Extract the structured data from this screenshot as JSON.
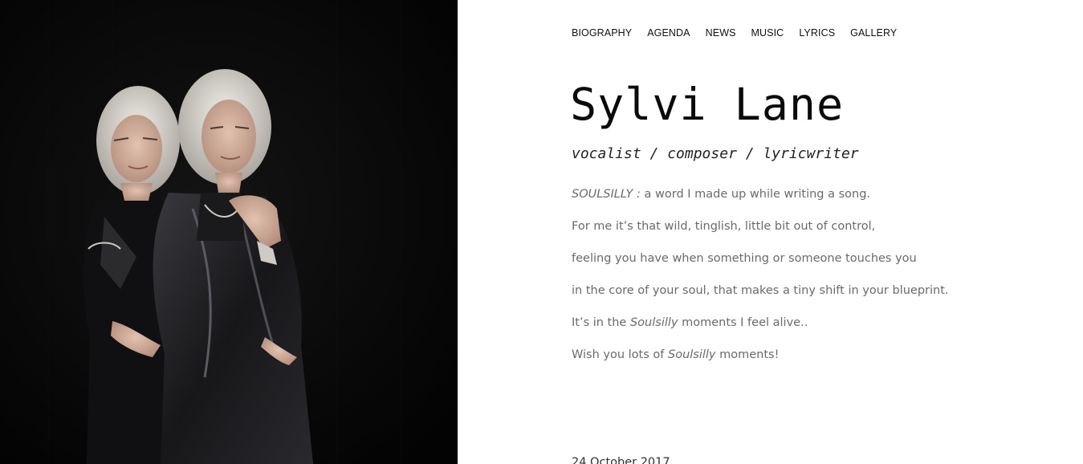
{
  "nav": {
    "items": [
      {
        "label": "BIOGRAPHY"
      },
      {
        "label": "AGENDA"
      },
      {
        "label": "NEWS"
      },
      {
        "label": "MUSIC"
      },
      {
        "label": "LYRICS"
      },
      {
        "label": "GALLERY"
      }
    ]
  },
  "header": {
    "title": "Sylvi Lane",
    "tagline": "vocalist / composer / lyricwriter"
  },
  "intro": {
    "line1_emphasis": "SOULSILLY :",
    "line1_rest": " a word I made up while writing a song.",
    "line2": "For me it’s that wild, tinglish, little bit out of control,",
    "line3": "feeling you have when something or someone touches you",
    "line4": "in the core of your soul, that makes a tiny shift in your blueprint.",
    "line5_pre": "It’s in the ",
    "line5_emphasis": "Soulsilly",
    "line5_post": " moments I feel alive..",
    "line6_pre": "Wish you lots of ",
    "line6_emphasis": "Soulsilly",
    "line6_post": " moments!"
  },
  "post": {
    "date": "24 October 2017"
  },
  "colors": {
    "photo_background": "#060606",
    "hair": "#d9d6d1",
    "skin": "#d8b3a0",
    "jacket": "#1c1c1e"
  },
  "photo": {
    "subject": "portrait-photo-two-women-back-to-back"
  }
}
